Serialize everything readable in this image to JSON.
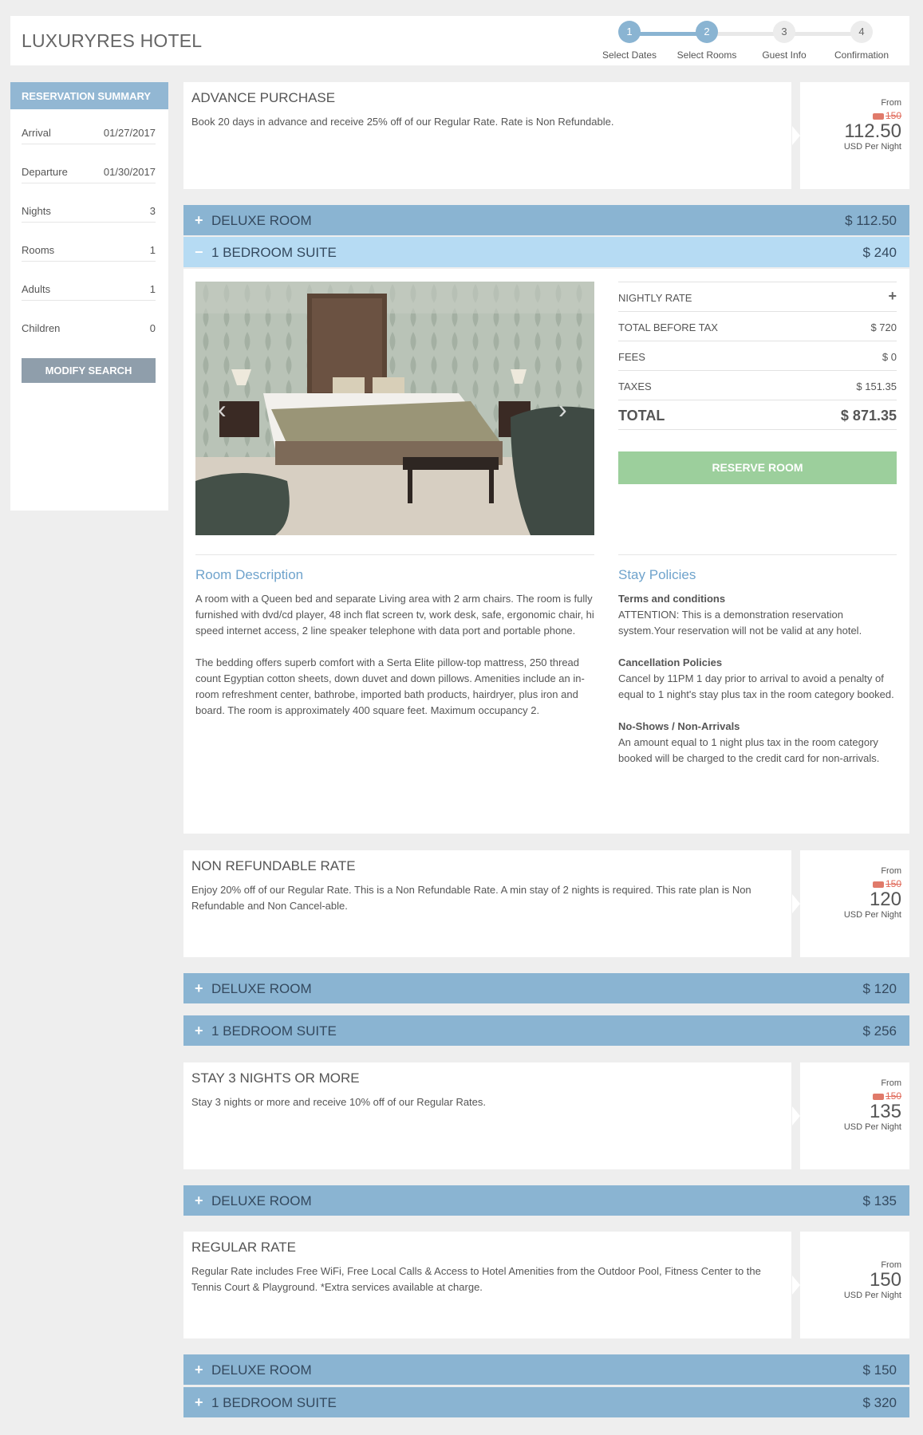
{
  "brand": "LUXURYRES HOTEL",
  "steps": [
    {
      "num": "1",
      "label": "Select Dates",
      "state": "done"
    },
    {
      "num": "2",
      "label": "Select Rooms",
      "state": "active"
    },
    {
      "num": "3",
      "label": "Guest Info",
      "state": "todo"
    },
    {
      "num": "4",
      "label": "Confirmation",
      "state": "todo"
    }
  ],
  "summary": {
    "title": "RESERVATION SUMMARY",
    "rows": [
      {
        "label": "Arrival",
        "value": "01/27/2017"
      },
      {
        "label": "Departure",
        "value": "01/30/2017"
      },
      {
        "label": "Nights",
        "value": "3"
      },
      {
        "label": "Rooms",
        "value": "1"
      },
      {
        "label": "Adults",
        "value": "1"
      },
      {
        "label": "Children",
        "value": "0"
      }
    ],
    "modify_label": "MODIFY SEARCH"
  },
  "rates": [
    {
      "title": "ADVANCE PURCHASE",
      "description": "Book 20 days in advance and receive 25% off of our Regular Rate. Rate is Non Refundable.",
      "from_label": "From",
      "old_price": "150",
      "price": "112.50",
      "per_label": "USD Per Night",
      "rooms": [
        {
          "name": "DELUXE ROOM",
          "price": "$ 112.50",
          "sign": "+",
          "open": false
        },
        {
          "name": "1 BEDROOM SUITE",
          "price": "$ 240",
          "sign": "−",
          "open": true
        }
      ]
    },
    {
      "title": "NON REFUNDABLE RATE",
      "description": "Enjoy 20% off of our Regular Rate. This is a Non Refundable Rate. A min stay of 2 nights is required. This rate plan is Non Refundable and Non Cancel-able.",
      "from_label": "From",
      "old_price": "150",
      "price": "120",
      "per_label": "USD Per Night",
      "rooms": [
        {
          "name": "DELUXE ROOM",
          "price": "$ 120",
          "sign": "+",
          "open": false
        },
        {
          "name": "1 BEDROOM SUITE",
          "price": "$ 256",
          "sign": "+",
          "open": false
        }
      ]
    },
    {
      "title": "STAY 3 NIGHTS OR MORE",
      "description": "Stay 3 nights or more and receive 10% off of our Regular Rates.",
      "from_label": "From",
      "old_price": "150",
      "price": "135",
      "per_label": "USD Per Night",
      "rooms": [
        {
          "name": "DELUXE ROOM",
          "price": "$ 135",
          "sign": "+",
          "open": false
        }
      ]
    },
    {
      "title": "REGULAR RATE",
      "description": "Regular Rate includes Free WiFi, Free Local Calls & Access to Hotel Amenities from the Outdoor Pool, Fitness Center to the Tennis Court & Playground. *Extra services available at charge.",
      "from_label": "From",
      "price": "150",
      "per_label": "USD Per Night",
      "rooms": [
        {
          "name": "DELUXE ROOM",
          "price": "$ 150",
          "sign": "+",
          "open": false
        },
        {
          "name": "1 BEDROOM SUITE",
          "price": "$ 320",
          "sign": "+",
          "open": false
        }
      ]
    }
  ],
  "suite_detail": {
    "costs": [
      {
        "label": "NIGHTLY RATE",
        "value": "+"
      },
      {
        "label": "TOTAL BEFORE TAX",
        "value": "$ 720"
      },
      {
        "label": "FEES",
        "value": "$ 0"
      },
      {
        "label": "TAXES",
        "value": "$ 151.35"
      }
    ],
    "total_label": "TOTAL",
    "total_value": "$ 871.35",
    "reserve_label": "RESERVE ROOM",
    "desc_title": "Room Description",
    "desc_p1": "A room with a Queen bed and separate Living area with 2 arm chairs. The room is fully furnished with dvd/cd player, 48 inch flat screen tv, work desk, safe, ergonomic chair, hi speed internet access, 2 line speaker telephone with data port and portable phone.",
    "desc_p2": "The bedding offers superb comfort with a Serta Elite pillow-top mattress, 250 thread count Egyptian cotton sheets, down duvet and down pillows. Amenities include an in-room refreshment center, bathrobe, imported bath products, hairdryer, plus iron and board. The room is approximately 400 square feet. Maximum occupancy 2.",
    "policy_title": "Stay Policies",
    "policies": [
      {
        "heading": "Terms and conditions",
        "body": "ATTENTION: This is a demonstration reservation system.Your reservation will not be valid at any hotel."
      },
      {
        "heading": "Cancellation Policies",
        "body": "Cancel by 11PM 1 day prior to arrival to avoid a penalty of equal to 1 night's stay plus tax in the room category booked."
      },
      {
        "heading": "No-Shows / Non-Arrivals",
        "body": "An amount equal to 1 night plus tax in the room category booked will be charged to the credit card for non-arrivals."
      }
    ]
  },
  "colors": {
    "accent": "#8ab4d2",
    "accent_light": "#b6dbf3",
    "reserve": "#9ccf9c",
    "step_active": "#8ab4d2",
    "strike": "#e06a5a"
  }
}
